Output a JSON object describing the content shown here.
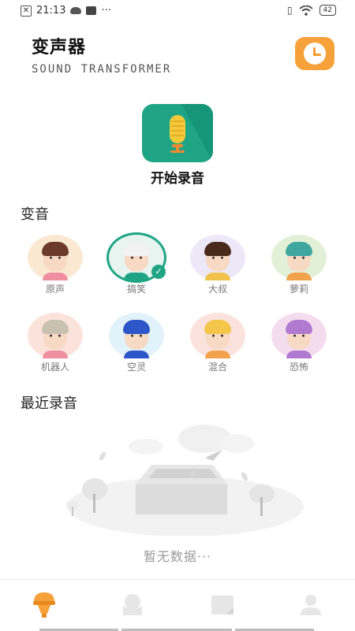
{
  "status_bar": {
    "time": "21:13",
    "dots": "···",
    "battery": "42"
  },
  "header": {
    "title": "变声器",
    "subtitle": "SOUND TRANSFORMER"
  },
  "record": {
    "label": "开始录音"
  },
  "voices_section": {
    "title": "变音",
    "items": [
      {
        "label": "原声",
        "bg": "#fbe8d2",
        "selected": false
      },
      {
        "label": "搞笑",
        "bg": "#e8f4ef",
        "selected": true
      },
      {
        "label": "大叔",
        "bg": "#ece8f8",
        "selected": false
      },
      {
        "label": "萝莉",
        "bg": "#e3f0d8",
        "selected": false
      },
      {
        "label": "机器人",
        "bg": "#fbe3dc",
        "selected": false
      },
      {
        "label": "空灵",
        "bg": "#e2f2fa",
        "selected": false
      },
      {
        "label": "混合",
        "bg": "#fbe2dc",
        "selected": false
      },
      {
        "label": "恐怖",
        "bg": "#f4dcef",
        "selected": false
      }
    ]
  },
  "recent": {
    "title": "最近录音",
    "empty_text": "暂无数据···"
  },
  "colors": {
    "accent": "#1fa586",
    "orange": "#f6a13a"
  },
  "tabs": [
    {
      "icon": "lightbulb-icon",
      "active": true
    },
    {
      "icon": "ghost-icon",
      "active": false
    },
    {
      "icon": "folder-icon",
      "active": false
    },
    {
      "icon": "person-icon",
      "active": false
    }
  ]
}
